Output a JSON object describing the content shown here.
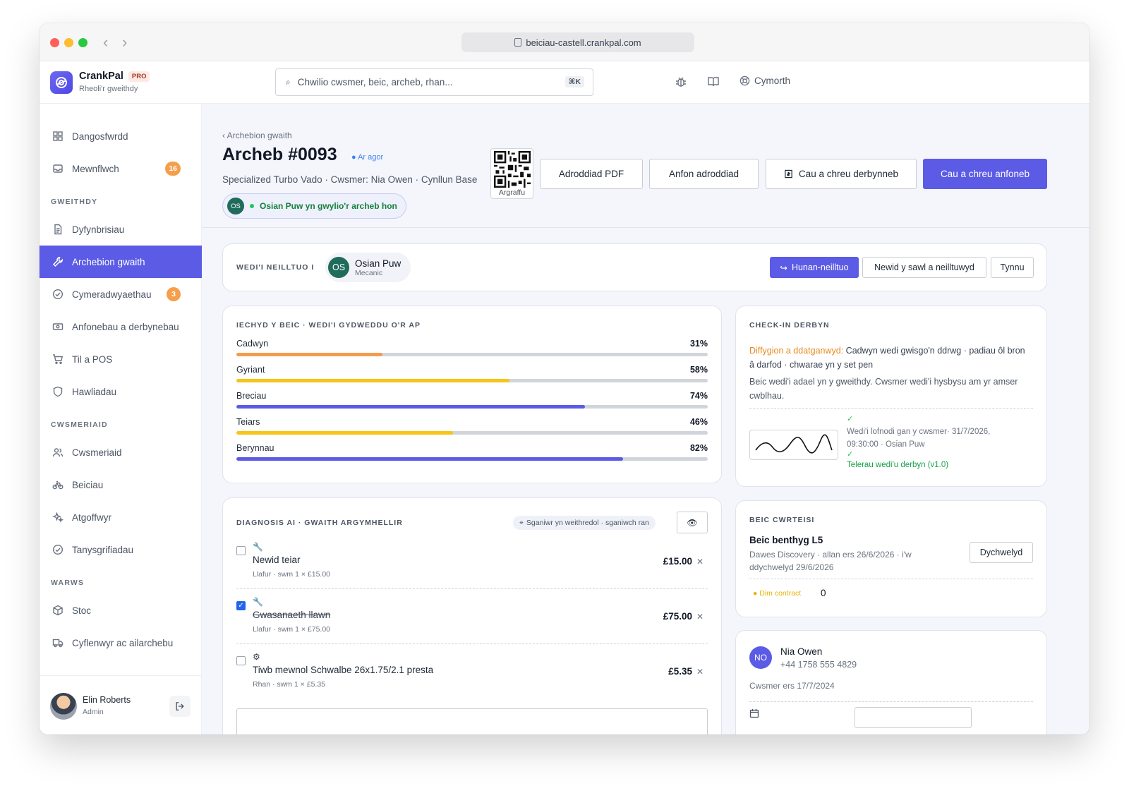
{
  "browser": {
    "url": "beiciau-castell.crankpal.com"
  },
  "app": {
    "name": "CrankPal",
    "badge": "PRO",
    "subtitle": "Rheoli'r gweithdy"
  },
  "search": {
    "placeholder": "Chwilio cwsmer, beic, archeb, rhan...",
    "shortcut": "⌘K"
  },
  "topbar": {
    "help_label": "Cymorth"
  },
  "sidebar": {
    "items": [
      {
        "label": "Dangosfwrdd",
        "icon": "dashboard-icon"
      },
      {
        "label": "Mewnflwch",
        "icon": "inbox-icon",
        "badge": "16"
      }
    ],
    "sections": [
      {
        "title": "GWEITHDY"
      },
      {
        "title": "CWSMERIAID"
      },
      {
        "title": "WARWS"
      }
    ],
    "workshop": [
      {
        "label": "Dyfynbrisiau",
        "icon": "document-icon"
      },
      {
        "label": "Archebion gwaith",
        "icon": "wrench-icon"
      },
      {
        "label": "Cymeradwyaethau",
        "icon": "check-circle-icon",
        "badge": "3"
      },
      {
        "label": "Anfonebau a derbynebau",
        "icon": "cash-icon"
      },
      {
        "label": "Til a POS",
        "icon": "cart-icon"
      },
      {
        "label": "Hawliadau",
        "icon": "shield-icon"
      }
    ],
    "customers": [
      {
        "label": "Cwsmeriaid",
        "icon": "users-icon"
      },
      {
        "label": "Beiciau",
        "icon": "bike-icon"
      },
      {
        "label": "Atgoffwyr",
        "icon": "sparkle-icon"
      },
      {
        "label": "Tanysgrifiadau",
        "icon": "check-circle-icon"
      }
    ],
    "warehouse": [
      {
        "label": "Stoc",
        "icon": "box-icon"
      },
      {
        "label": "Cyflenwyr ac ailarchebu",
        "icon": "truck-icon"
      }
    ],
    "user": {
      "name": "Elin Roberts",
      "role": "Admin"
    }
  },
  "order": {
    "breadcrumb": "‹ Archebion gwaith",
    "title": "Archeb #0093",
    "status": "Ar agor",
    "subtitle": "Specialized Turbo Vado · Cwsmer: Nia Owen · Cynllun Base",
    "watcher_initials": "OS",
    "watcher_text": "Osian Puw yn gwylio'r archeb hon",
    "qr_label": "Argraffu",
    "actions": {
      "pdf": "Adroddiad PDF",
      "send": "Anfon adroddiad",
      "receipt": "Cau a chreu derbynneb",
      "invoice": "Cau a chreu anfoneb"
    }
  },
  "assignment": {
    "label": "WEDI'I NEILLTUO I",
    "initials": "OS",
    "name": "Osian Puw",
    "role": "Mecanic",
    "self_assign": "Hunan-neilltuo",
    "change_multi": "Newid y sawl a neilltuwyd",
    "remove": "Tynnu"
  },
  "health": {
    "label": "IECHYD Y BEIC · WEDI'I GYDWEDDU O'R AP",
    "rows": [
      {
        "name": "Cadwyn",
        "value": 31,
        "display": "31%",
        "color": "#f29d4b"
      },
      {
        "name": "Gyriant",
        "value": 58,
        "display": "58%",
        "color": "#f5c518"
      },
      {
        "name": "Breciau",
        "value": 74,
        "display": "74%",
        "color": "#5b5be6"
      },
      {
        "name": "Teiars",
        "value": 46,
        "display": "46%",
        "color": "#f5c518"
      },
      {
        "name": "Berynnau",
        "value": 82,
        "display": "82%",
        "color": "#5b5be6"
      }
    ]
  },
  "checkin": {
    "label": "CHECK-IN DERBYN",
    "defect_label": "Diffygion a ddatganwyd:",
    "defect_text": " Cadwyn wedi gwisgo'n ddrwg · padiau ôl bron â darfod · chwarae yn y set pen",
    "notice": "Beic wedi'i adael yn y gweithdy. Cwsmer wedi'i hysbysu am yr amser cwblhau.",
    "signed": "Wedi'i lofnodi gan y cwsmer· 31/7/2026, 09:30:00 · Osian Puw",
    "terms": "Telerau wedi'u derbyn (v1.0)"
  },
  "diagnosis": {
    "label": "DIAGNOSIS AI · GWAITH ARGYMHELLIR",
    "scanner": "Sganiwr yn weithredol · sganiwch ran",
    "lines": [
      {
        "title": "Newid teiar",
        "meta": "Llafur · swm 1 × £15.00",
        "price": "£15.00",
        "checked": false,
        "icon": "wrench-icon"
      },
      {
        "title": "Gwasanaeth llawn",
        "meta": "Llafur · swm 1 × £75.00",
        "price": "£75.00",
        "checked": true,
        "icon": "wrench-icon"
      },
      {
        "title": "Tiwb mewnol Schwalbe 26x1.75/2.1 presta",
        "meta": "Rhan · swm 1 × £5.35",
        "price": "£5.35",
        "checked": false,
        "icon": "gear-icon"
      }
    ]
  },
  "loaner": {
    "label": "BEIC CWRTEISI",
    "title": "Beic benthyg L5",
    "desc": "Dawes Discovery · allan ers 26/6/2026 · i'w ddychwelyd 29/6/2026",
    "return": "Dychwelyd",
    "contract": "Dim contract",
    "count": "0"
  },
  "customer": {
    "initials": "NO",
    "name": "Nia Owen",
    "phone": "+44 1758 555 4829",
    "since": "Cwsmer ers 17/7/2024"
  }
}
